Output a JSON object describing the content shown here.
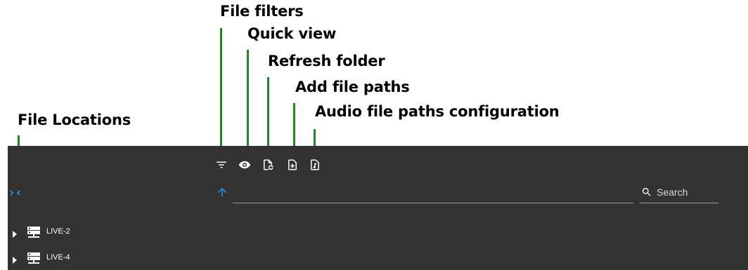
{
  "annotations": {
    "file_filters": "File filters",
    "quick_view": "Quick view",
    "refresh_folder": "Refresh folder",
    "add_file_paths": "Add file paths",
    "audio_config": "Audio file paths configuration",
    "file_locations": "File Locations"
  },
  "colors": {
    "panel_bg": "#333333",
    "leader_line": "#1f8a1f",
    "accent": "#2196f3"
  },
  "toolbar": {
    "icons": [
      "filter-icon",
      "eye-icon",
      "refresh-file-icon",
      "add-file-icon",
      "audio-file-icon"
    ]
  },
  "navigation": {
    "path_value": ""
  },
  "search": {
    "placeholder": "Search"
  },
  "tree": {
    "items": [
      {
        "label": "LIVE-2"
      },
      {
        "label": "LIVE-4"
      }
    ]
  }
}
